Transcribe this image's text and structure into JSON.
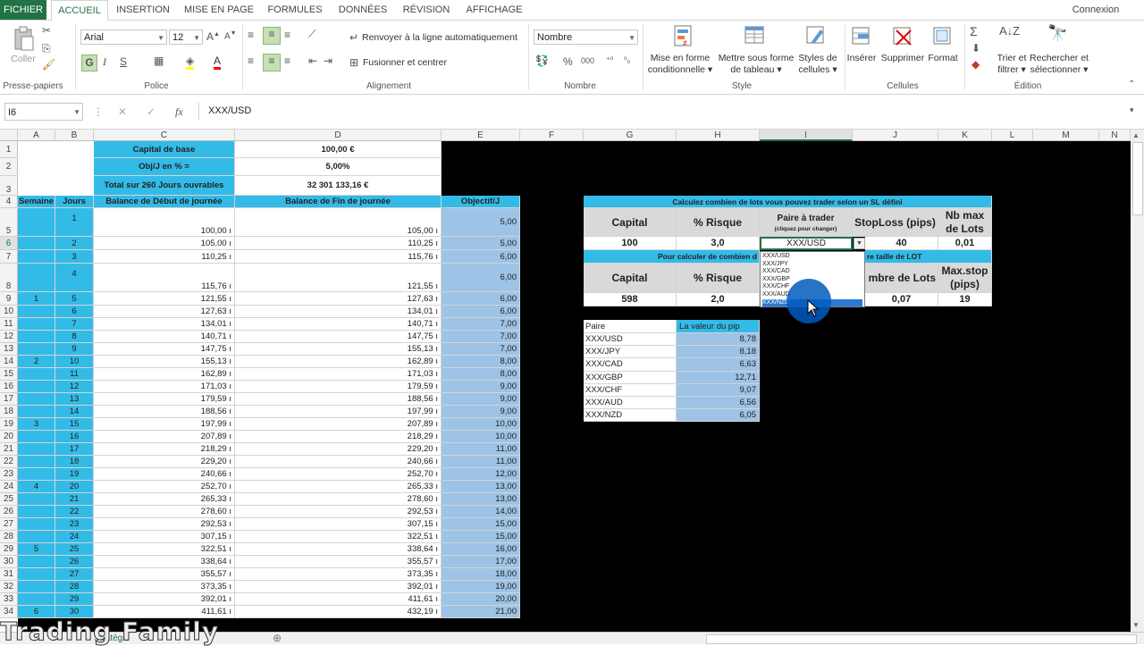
{
  "ribbon": {
    "tabs": [
      "FICHIER",
      "ACCUEIL",
      "INSERTION",
      "MISE EN PAGE",
      "FORMULES",
      "DONNÉES",
      "RÉVISION",
      "AFFICHAGE"
    ],
    "active_tab": "ACCUEIL",
    "signin": "Connexion",
    "font_name": "Arial",
    "font_size": "12",
    "number_format": "Nombre",
    "paste": "Coller",
    "wrap_text": "Renvoyer à la ligne automatiquement",
    "merge_center": "Fusionner et centrer",
    "bold": "G",
    "italic": "I",
    "underline": "S",
    "pct": "%",
    "thousands": "000",
    "cond_format": [
      "Mise en forme",
      "conditionnelle"
    ],
    "table_format": [
      "Mettre sous forme",
      "de tableau"
    ],
    "cell_styles": [
      "Styles de",
      "cellules"
    ],
    "insert": "Insérer",
    "delete": "Supprimer",
    "format": "Format",
    "sort_filter": [
      "Trier et",
      "filtrer"
    ],
    "find_select": [
      "Rechercher et",
      "sélectionner"
    ],
    "groups": [
      "Presse-papiers",
      "Police",
      "Alignement",
      "Nombre",
      "Style",
      "Cellules",
      "Édition"
    ]
  },
  "formula_bar": {
    "name_box": "I6",
    "fx": "fx",
    "value": "XXX/USD"
  },
  "columns": [
    "A",
    "B",
    "C",
    "D",
    "E",
    "F",
    "G",
    "H",
    "I",
    "J",
    "K",
    "L",
    "M",
    "N"
  ],
  "rows": [
    "1",
    "2",
    "3",
    "4",
    "5",
    "6",
    "7",
    "8",
    "9",
    "10",
    "11",
    "12",
    "13",
    "14",
    "15",
    "16",
    "17",
    "18",
    "19",
    "20",
    "21",
    "22",
    "23",
    "24",
    "25",
    "26",
    "27",
    "28",
    "29",
    "30",
    "31",
    "32",
    "33",
    "34"
  ],
  "top": {
    "capital_label": "Capital de base",
    "capital_value": "100,00 €",
    "obj_label": "Obj/J en % =",
    "obj_value": "5,00%",
    "total_label": "Total sur 260 Jours ouvrables",
    "total_value": "32 301 133,16 €"
  },
  "headers": {
    "semaine": "Semaine",
    "jours": "Jours",
    "debut": "Balance de Début de journée",
    "fin": "Balance de Fin de journée",
    "objectif": "Objectif/J"
  },
  "weeks": [
    "1",
    "2",
    "3",
    "4",
    "5",
    "6"
  ],
  "data_rows": [
    {
      "day": "1",
      "start": "100,00 ı",
      "end": "105,00 ı",
      "obj": "5,00"
    },
    {
      "day": "2",
      "start": "105,00 ı",
      "end": "110,25 ı",
      "obj": "5,00"
    },
    {
      "day": "3",
      "start": "110,25 ı",
      "end": "115,76 ı",
      "obj": "6,00"
    },
    {
      "day": "4",
      "start": "115,76 ı",
      "end": "121,55 ı",
      "obj": "6,00"
    },
    {
      "day": "5",
      "start": "121,55 ı",
      "end": "127,63 ı",
      "obj": "6,00"
    },
    {
      "day": "6",
      "start": "127,63 ı",
      "end": "134,01 ı",
      "obj": "6,00"
    },
    {
      "day": "7",
      "start": "134,01 ı",
      "end": "140,71 ı",
      "obj": "7,00"
    },
    {
      "day": "8",
      "start": "140,71 ı",
      "end": "147,75 ı",
      "obj": "7,00"
    },
    {
      "day": "9",
      "start": "147,75 ı",
      "end": "155,13 ı",
      "obj": "7,00"
    },
    {
      "day": "10",
      "start": "155,13 ı",
      "end": "162,89 ı",
      "obj": "8,00"
    },
    {
      "day": "11",
      "start": "162,89 ı",
      "end": "171,03 ı",
      "obj": "8,00"
    },
    {
      "day": "12",
      "start": "171,03 ı",
      "end": "179,59 ı",
      "obj": "9,00"
    },
    {
      "day": "13",
      "start": "179,59 ı",
      "end": "188,56 ı",
      "obj": "9,00"
    },
    {
      "day": "14",
      "start": "188,56 ı",
      "end": "197,99 ı",
      "obj": "9,00"
    },
    {
      "day": "15",
      "start": "197,99 ı",
      "end": "207,89 ı",
      "obj": "10,00"
    },
    {
      "day": "16",
      "start": "207,89 ı",
      "end": "218,29 ı",
      "obj": "10,00"
    },
    {
      "day": "17",
      "start": "218,29 ı",
      "end": "229,20 ı",
      "obj": "11,00"
    },
    {
      "day": "18",
      "start": "229,20 ı",
      "end": "240,66 ı",
      "obj": "11,00"
    },
    {
      "day": "19",
      "start": "240,66 ı",
      "end": "252,70 ı",
      "obj": "12,00"
    },
    {
      "day": "20",
      "start": "252,70 ı",
      "end": "265,33 ı",
      "obj": "13,00"
    },
    {
      "day": "21",
      "start": "265,33 ı",
      "end": "278,60 ı",
      "obj": "13,00"
    },
    {
      "day": "22",
      "start": "278,60 ı",
      "end": "292,53 ı",
      "obj": "14,00"
    },
    {
      "day": "23",
      "start": "292,53 ı",
      "end": "307,15 ı",
      "obj": "15,00"
    },
    {
      "day": "24",
      "start": "307,15 ı",
      "end": "322,51 ı",
      "obj": "15,00"
    },
    {
      "day": "25",
      "start": "322,51 ı",
      "end": "338,64 ı",
      "obj": "16,00"
    },
    {
      "day": "26",
      "start": "338,64 ı",
      "end": "355,57 ı",
      "obj": "17,00"
    },
    {
      "day": "27",
      "start": "355,57 ı",
      "end": "373,35 ı",
      "obj": "18,00"
    },
    {
      "day": "28",
      "start": "373,35 ı",
      "end": "392,01 ı",
      "obj": "19,00"
    },
    {
      "day": "29",
      "start": "392,01 ı",
      "end": "411,61 ı",
      "obj": "20,00"
    },
    {
      "day": "30",
      "start": "411,61 ı",
      "end": "432,19 ı",
      "obj": "21,00"
    }
  ],
  "calc": {
    "title1": "Calculez combien de lots vous pouvez trader selon un SL défini",
    "h_capital": "Capital",
    "h_risque": "% Risque",
    "h_paire": "Paire à trader",
    "h_paire_sub": "(cliquez pour changer)",
    "h_stop": "StopLoss (pips)",
    "h_nbmax": [
      "Nb max",
      "de Lots"
    ],
    "capital": "100",
    "risque": "3,0",
    "paire": "XXX/USD",
    "stop": "40",
    "nbmax": "0,01",
    "title2_left": "Pour calculer de combien d",
    "title2_right": "re taille de LOT",
    "h2_capital": "Capital",
    "h2_risque": "% Risque",
    "h2_lots": "mbre de Lots",
    "h2_maxstop": [
      "Max.stop",
      "(pips)"
    ],
    "capital2": "598",
    "risque2": "2,0",
    "lots2": "0,07",
    "maxstop2": "19"
  },
  "pip_table": {
    "headers": [
      "Paire",
      "La valeur du pip"
    ],
    "rows": [
      {
        "pair": "XXX/USD",
        "value": "8,78"
      },
      {
        "pair": "XXX/JPY",
        "value": "8,18"
      },
      {
        "pair": "XXX/CAD",
        "value": "6,63"
      },
      {
        "pair": "XXX/GBP",
        "value": "12,71"
      },
      {
        "pair": "XXX/CHF",
        "value": "9,07"
      },
      {
        "pair": "XXX/AUD",
        "value": "6,56"
      },
      {
        "pair": "XXX/NZD",
        "value": "6,05"
      }
    ]
  },
  "dropdown_options": [
    "XXX/USD",
    "XXX/JPY",
    "XXX/CAD",
    "XXX/GBP",
    "XXX/CHF",
    "XXX/AUD",
    "XXX/NZD"
  ],
  "dropdown_selected_index": 6,
  "watermark": "Trading Family",
  "sheet_tab_partial": "Stratégie"
}
